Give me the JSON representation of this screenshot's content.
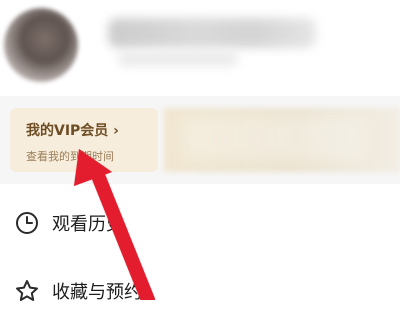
{
  "vip_card": {
    "title": "我的VIP会员 ›",
    "subtitle": "查看我的到期时间"
  },
  "menu": {
    "items": [
      {
        "label": "观看历史",
        "icon": "clock-icon"
      },
      {
        "label": "收藏与预约",
        "icon": "star-icon"
      }
    ]
  },
  "annotation": {
    "arrow_color": "#e31c2d"
  },
  "colors": {
    "vip_card_bg": "#f7eddc",
    "vip_title": "#6d4d24",
    "vip_subtitle": "#9a7d57"
  }
}
